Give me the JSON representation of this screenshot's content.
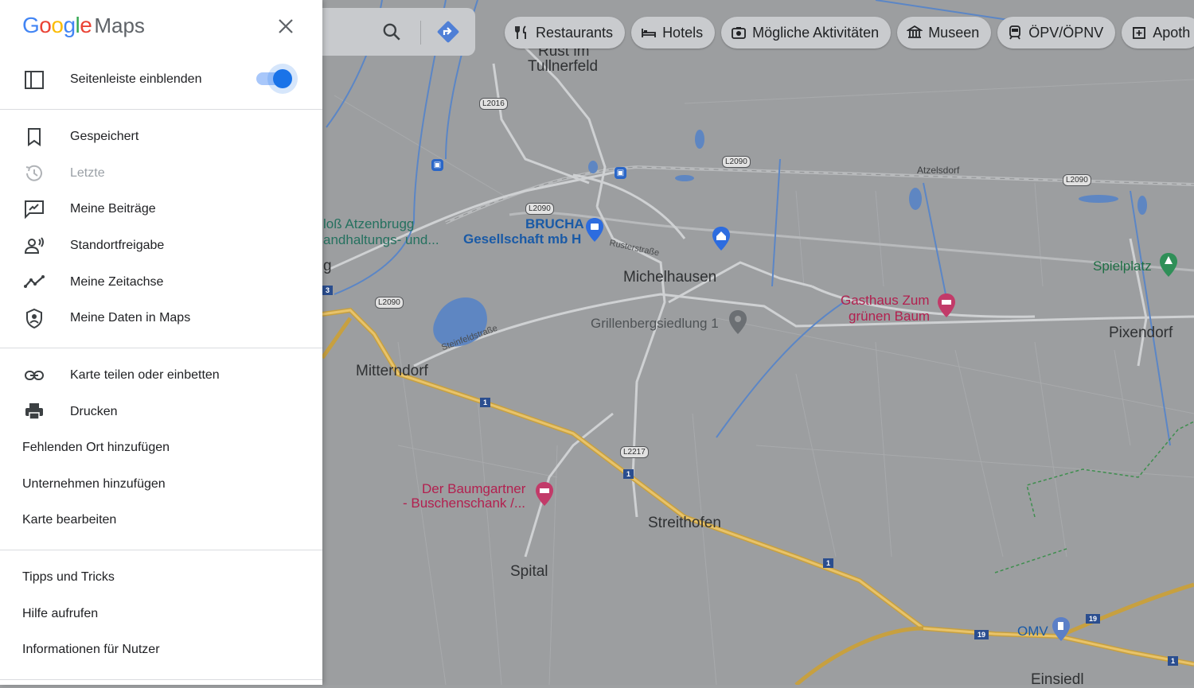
{
  "logo": {
    "g1": "G",
    "o1": "o",
    "o2": "o",
    "g2": "g",
    "l": "l",
    "e": "e",
    "maps": "Maps"
  },
  "colors": {
    "google_blue": "#4285F4",
    "google_red": "#EA4335",
    "google_yellow": "#FBBC05",
    "google_green": "#34A853",
    "toggle_on": "#1a73e8",
    "map_poi_red": "#b2204f",
    "map_poi_blue": "#1a5aa6"
  },
  "sidebar": {
    "toggle": {
      "label": "Seitenleiste einblenden",
      "icon": "sidebar-panel-icon",
      "state": "on"
    },
    "section1": [
      {
        "label": "Gespeichert",
        "icon": "bookmark-icon"
      },
      {
        "label": "Letzte",
        "icon": "history-icon",
        "disabled": true
      },
      {
        "label": "Meine Beiträge",
        "icon": "contributions-icon"
      },
      {
        "label": "Standortfreigabe",
        "icon": "location-sharing-icon"
      },
      {
        "label": "Meine Zeitachse",
        "icon": "timeline-icon"
      },
      {
        "label": "Meine Daten in Maps",
        "icon": "shield-person-icon"
      }
    ],
    "section2": [
      {
        "label": "Karte teilen oder einbetten",
        "icon": "link-icon"
      },
      {
        "label": "Drucken",
        "icon": "printer-icon"
      },
      {
        "label": "Fehlenden Ort hinzufügen"
      },
      {
        "label": "Unternehmen hinzufügen"
      },
      {
        "label": "Karte bearbeiten"
      }
    ],
    "section3": [
      {
        "label": "Tipps und Tricks"
      },
      {
        "label": "Hilfe aufrufen"
      },
      {
        "label": "Informationen für Nutzer"
      }
    ]
  },
  "search": {
    "search_icon": "search-icon",
    "directions_icon": "directions-icon"
  },
  "chips": [
    {
      "label": "Restaurants",
      "icon": "fork-knife-icon"
    },
    {
      "label": "Hotels",
      "icon": "bed-icon"
    },
    {
      "label": "Mögliche Aktivitäten",
      "icon": "camera-icon"
    },
    {
      "label": "Museen",
      "icon": "museum-icon"
    },
    {
      "label": "ÖPV/ÖPNV",
      "icon": "train-icon"
    },
    {
      "label": "Apoth",
      "icon": "pharmacy-icon"
    }
  ],
  "map": {
    "places": {
      "rust": "Rust im",
      "tullnerfeld": "Tullnerfeld",
      "atzelsdorf": "Atzelsdorf",
      "michelhausen": "Michelhausen",
      "mitterndorf": "Mitterndorf",
      "pixendorf": "Pixendorf",
      "streithofen": "Streithofen",
      "spital": "Spital",
      "einsiedl": "Einsiedl",
      "g_fragment": "g"
    },
    "pois": {
      "schloss1": "loß Atzenbrugg",
      "schloss2": "andhaltungs- und...",
      "brucha1": "BRUCHA",
      "brucha2": "Gesellschaft mb H",
      "gasthaus1": "Gasthaus Zum",
      "gasthaus2": "grünen Baum",
      "grillenberg": "Grillenbergsiedlung 1",
      "spielplatz": "Spielplatz",
      "baumgartner1": "Der Baumgartner",
      "baumgartner2": "- Buschenschank /...",
      "omv": "OMV"
    },
    "streets": {
      "rusterstrasse": "Rusterstraße",
      "steinfeldstrasse": "Steinfeldstraße"
    },
    "shields": {
      "l2016": "L2016",
      "l2090a": "L2090",
      "l2090b": "L2090",
      "l2090c": "L2090",
      "l2090d": "L2090",
      "l2217": "L2217",
      "a1a": "1",
      "a1b": "1",
      "a1c": "1",
      "a1d": "1",
      "s19a": "19",
      "s19b": "19",
      "s3": "3"
    }
  }
}
